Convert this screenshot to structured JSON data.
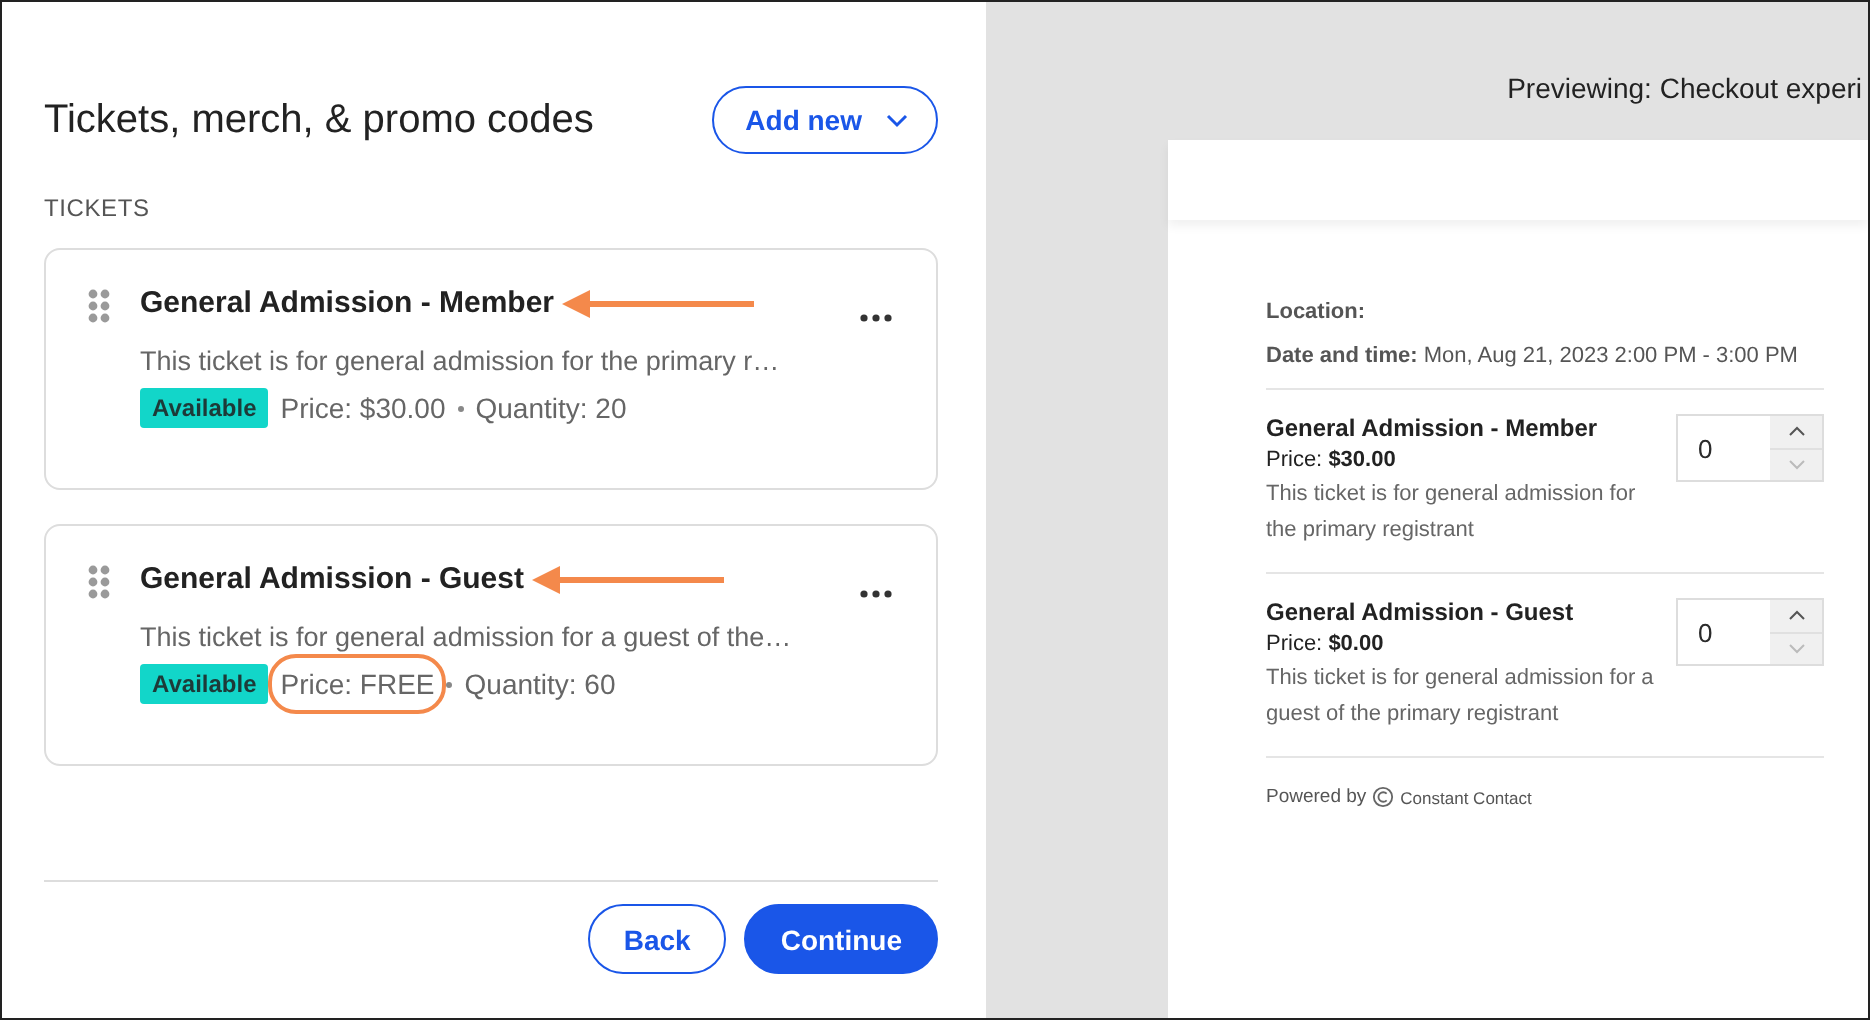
{
  "editor": {
    "title": "Tickets, merch, & promo codes",
    "add_button": "Add new",
    "section_label": "TICKETS",
    "tickets": [
      {
        "name": "General Admission - Member",
        "description": "This ticket is for general admission for the primary r…",
        "status": "Available",
        "price": "Price: $30.00",
        "quantity": "Quantity: 20",
        "arrow": true,
        "price_circled": false
      },
      {
        "name": "General Admission - Guest",
        "description": "This ticket is for general admission for a guest of the…",
        "status": "Available",
        "price": "Price: FREE",
        "quantity": "Quantity: 60",
        "arrow": true,
        "price_circled": true
      }
    ],
    "buttons": [
      {
        "label": "Back",
        "kind": "secondary"
      },
      {
        "label": "Continue",
        "kind": "primary"
      }
    ]
  },
  "preview": {
    "heading": "Previewing: Checkout experi",
    "location_label": "Location:",
    "date_label": "Date and time:",
    "date_value": "Mon, Aug 21, 2023 2:00 PM - 3:00 PM",
    "tickets": [
      {
        "name": "General Admission - Member",
        "price": "Price: **$30.00**",
        "description": "This ticket is for general admission for the primary registrant",
        "quantity": "0"
      },
      {
        "name": "General Admission - Guest",
        "price": "Price: **$0.00**",
        "description": "This ticket is for general admission for a guest of the primary registrant",
        "quantity": "0"
      }
    ],
    "powered_by": "Powered by",
    "brand": "Constant Contact"
  }
}
